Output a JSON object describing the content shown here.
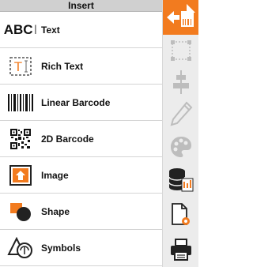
{
  "panel": {
    "header": "Insert",
    "items": [
      {
        "id": "text",
        "label": "Text",
        "icon": "text-icon",
        "icon_text": "ABC"
      },
      {
        "id": "rich-text",
        "label": "Rich Text",
        "icon": "rich-text-icon",
        "icon_text": "T"
      },
      {
        "id": "linear-barcode",
        "label": "Linear Barcode",
        "icon": "linear-barcode-icon"
      },
      {
        "id": "2d-barcode",
        "label": "2D Barcode",
        "icon": "qr-code-icon"
      },
      {
        "id": "image",
        "label": "Image",
        "icon": "image-icon"
      },
      {
        "id": "shape",
        "label": "Shape",
        "icon": "shape-icon"
      },
      {
        "id": "symbols",
        "label": "Symbols",
        "icon": "symbols-icon"
      }
    ]
  },
  "sidebar": {
    "items": [
      {
        "id": "insert",
        "icon": "insert-icon",
        "active": true
      },
      {
        "id": "select-area",
        "icon": "select-area-icon",
        "active": false
      },
      {
        "id": "align",
        "icon": "align-icon",
        "active": false
      },
      {
        "id": "edit",
        "icon": "pencil-icon",
        "active": false
      },
      {
        "id": "color",
        "icon": "palette-icon",
        "active": false
      },
      {
        "id": "database",
        "icon": "database-icon",
        "active": false
      },
      {
        "id": "page-settings",
        "icon": "page-settings-icon",
        "active": false
      },
      {
        "id": "print",
        "icon": "printer-icon",
        "active": false
      }
    ]
  },
  "colors": {
    "accent": "#f27b1f",
    "active_sidebar": "#f27b1f",
    "grey": "#c8c8c8",
    "dark": "#222222"
  }
}
